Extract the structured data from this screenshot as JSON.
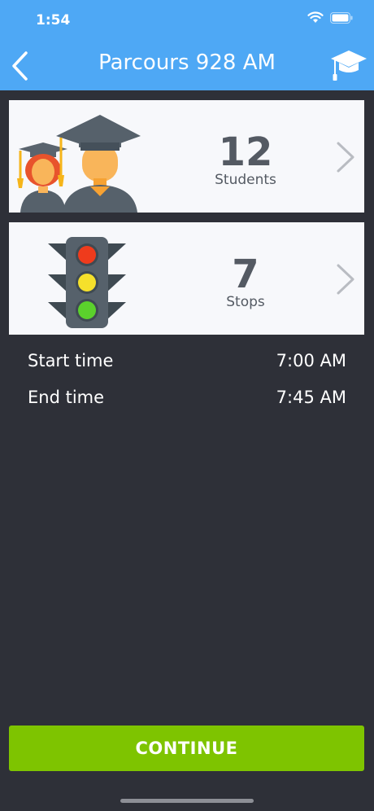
{
  "status_bar": {
    "time": "1:54"
  },
  "header": {
    "title": "Parcours 928 AM"
  },
  "cards": {
    "students": {
      "count": "12",
      "label": "Students"
    },
    "stops": {
      "count": "7",
      "label": "Stops"
    }
  },
  "details": {
    "start": {
      "label": "Start time",
      "value": "7:00 AM"
    },
    "end": {
      "label": "End time",
      "value": "7:45 AM"
    }
  },
  "actions": {
    "continue_label": "CONTINUE"
  },
  "colors": {
    "header": "#4ea8f5",
    "background": "#2e3038",
    "card": "#f7f8fb",
    "continue": "#7ec400"
  },
  "icons": [
    "wifi-icon",
    "battery-icon",
    "back-chevron-icon",
    "graduation-cap-icon",
    "students-illustration",
    "traffic-light-illustration",
    "chevron-right-icon"
  ]
}
